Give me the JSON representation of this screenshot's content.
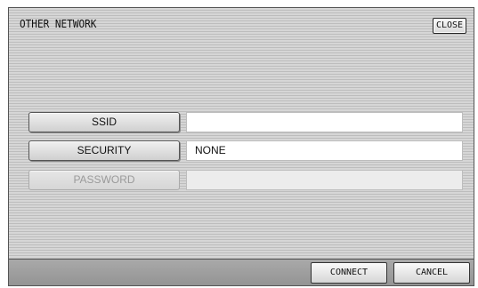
{
  "dialog": {
    "title": "OTHER NETWORK",
    "close_label": "CLOSE"
  },
  "fields": [
    {
      "label": "SSID",
      "value": "",
      "enabled": true
    },
    {
      "label": "SECURITY",
      "value": "NONE",
      "enabled": true
    },
    {
      "label": "PASSWORD",
      "value": "",
      "enabled": false
    }
  ],
  "footer": {
    "connect_label": "CONNECT",
    "cancel_label": "CANCEL"
  },
  "colors": {
    "panel_stripe_light": "#d6d6d6",
    "panel_stripe_dark": "#bdbdbd",
    "footer_bar": "#9e9e9e"
  }
}
